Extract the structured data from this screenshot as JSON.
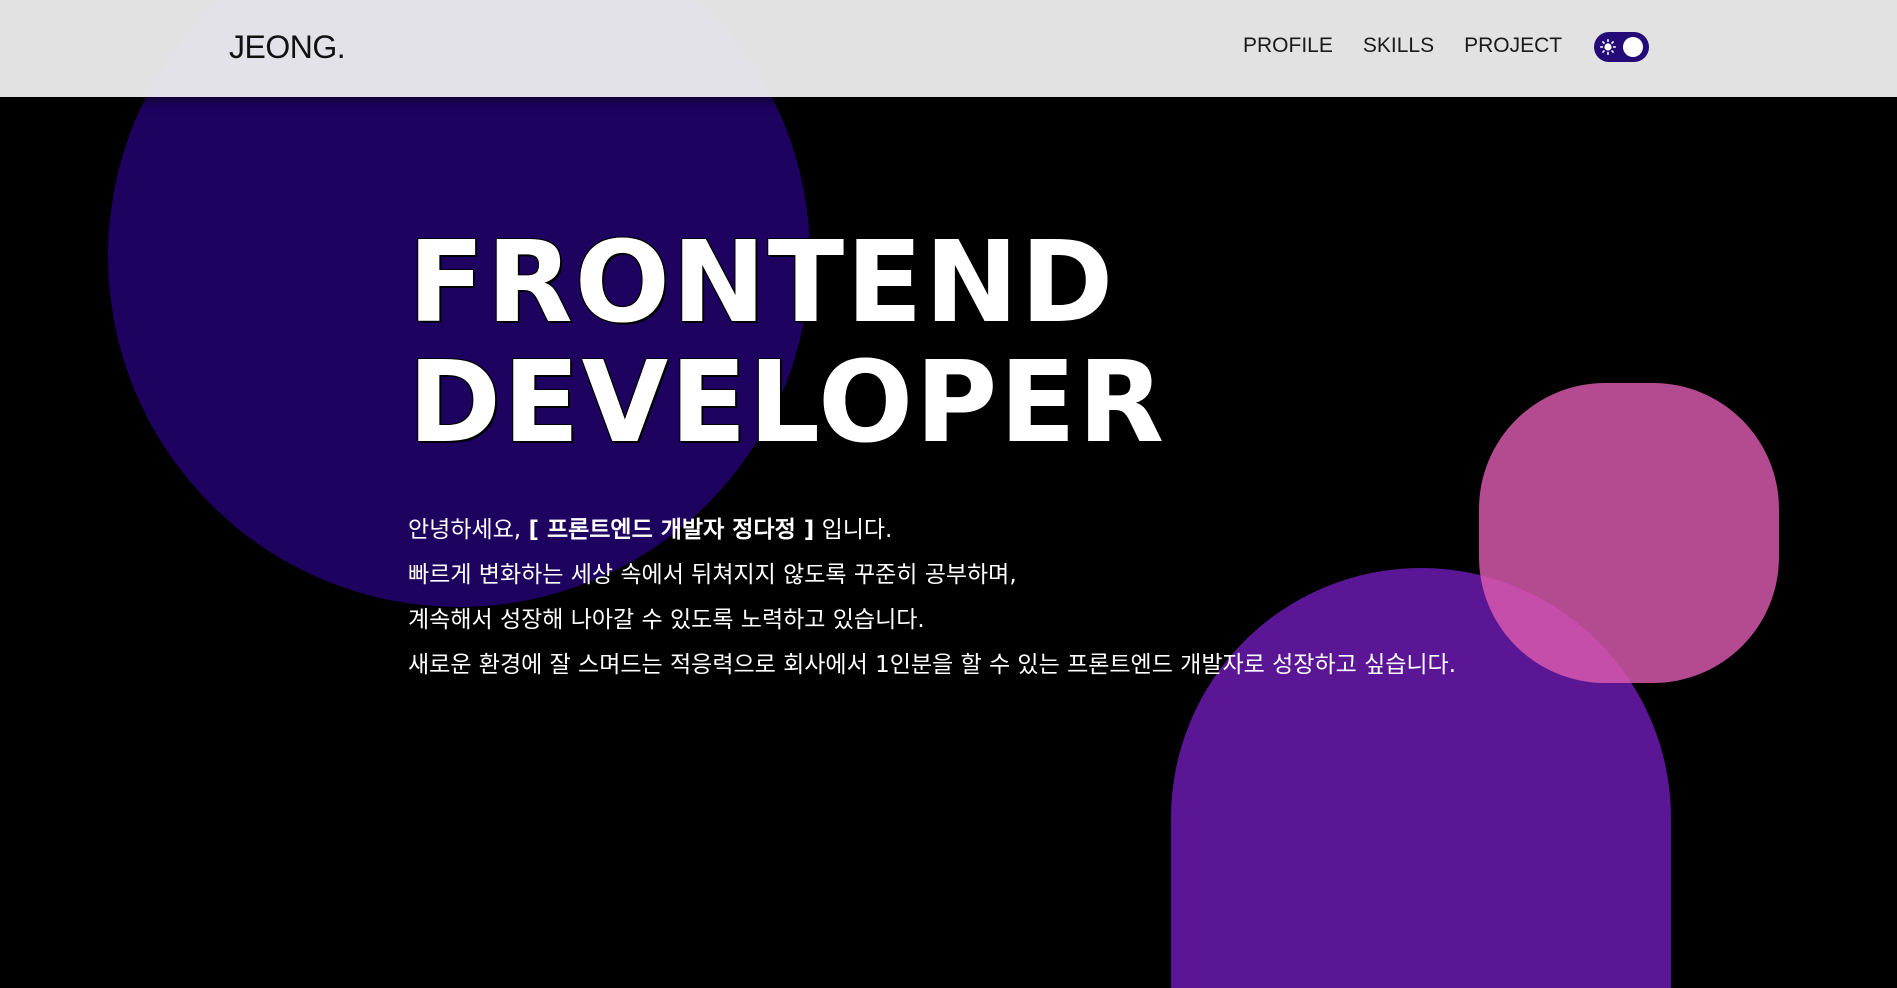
{
  "header": {
    "logo": "JEONG.",
    "nav": {
      "profile": "PROFILE",
      "skills": "SKILLS",
      "project": "PROJECT"
    },
    "theme_toggle": {
      "icon": "sun-icon",
      "state": "on"
    }
  },
  "hero": {
    "title_line1": "FRONTEND",
    "title_line2": "DEVELOPER"
  },
  "intro": {
    "line1_prefix": "안녕하세요, ",
    "line1_highlight": "[ 프론트엔드 개발자 정다정 ]",
    "line1_suffix": " 입니다.",
    "line2": "빠르게 변화하는 세상 속에서 뒤쳐지지 않도록 꾸준히 공부하며,",
    "line3": "계속해서 성장해 나아갈 수 있도록 노력하고 있습니다.",
    "line4": "새로운 환경에 잘 스며드는 적응력으로 회사에서 1인분을 할 수 있는 프론트엔드 개발자로 성장하고 싶습니다."
  },
  "colors": {
    "background": "#000000",
    "header_bg": "#f0f0f0",
    "navy_blob": "#1e0260",
    "purple_blob": "#5a1694",
    "pink_blob": "#dc5aaf",
    "toggle_bg": "#250b77",
    "text": "#ffffff"
  }
}
